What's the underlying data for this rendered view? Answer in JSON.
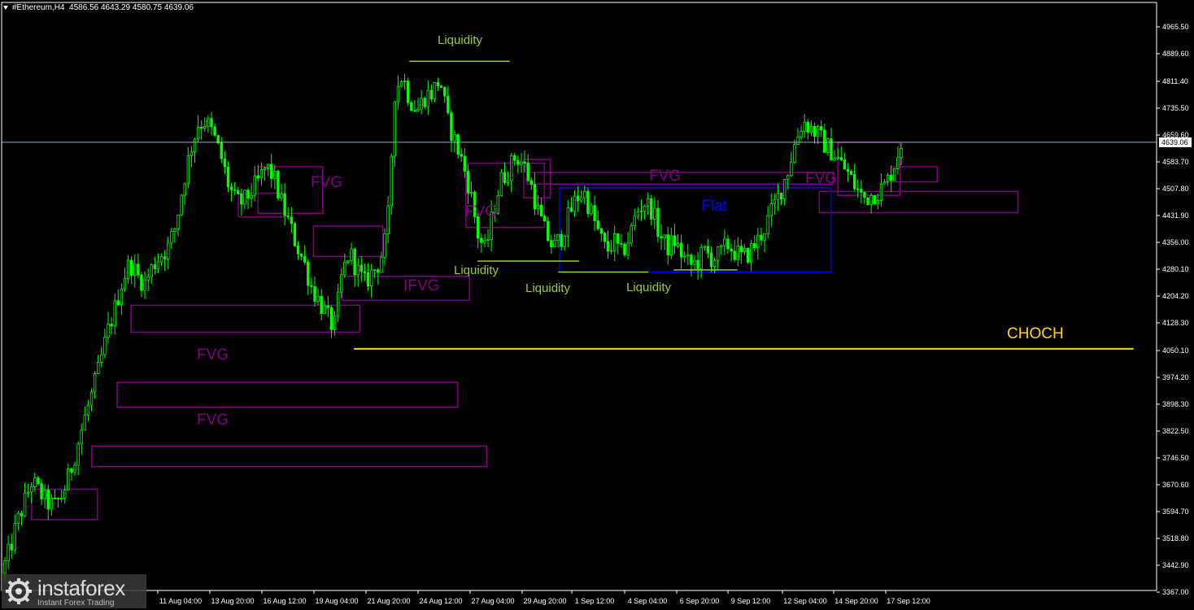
{
  "header": {
    "symbol": "#Ethereum,H4",
    "ohlc": "4586.56 4643.29 4580.75 4639.06"
  },
  "colors": {
    "background": "#000000",
    "candle": "#00ff00",
    "fvg": "#800080",
    "liquidity": "#9acd32",
    "flat": "#0000ff",
    "choch": "#ffd700",
    "axis": "#ffffff",
    "price_line": "#b0c4de"
  },
  "watermark": {
    "brand": "instaforex",
    "tagline": "Instant Forex Trading"
  },
  "chart_data": {
    "type": "candlestick",
    "symbol": "#Ethereum",
    "timeframe": "H4",
    "ylim": [
      3367,
      5000
    ],
    "y_ticks": [
      "4965.50",
      "4889.60",
      "4811.40",
      "4735.50",
      "4659.60",
      "4583.70",
      "4507.80",
      "4431.90",
      "4356.00",
      "4280.10",
      "4204.20",
      "4128.30",
      "4050.10",
      "3974.20",
      "3898.30",
      "3822.50",
      "3746.50",
      "3670.60",
      "3594.70",
      "3518.80",
      "3442.90",
      "3367.00"
    ],
    "x_ticks": [
      "11 Aug 04:00",
      "13 Aug 20:00",
      "16 Aug 12:00",
      "19 Aug 04:00",
      "21 Aug 20:00",
      "24 Aug 12:00",
      "27 Aug 04:00",
      "29 Aug 20:00",
      "1 Sep 12:00",
      "4 Sep 04:00",
      "6 Sep 20:00",
      "9 Sep 12:00",
      "12 Sep 04:00",
      "14 Sep 20:00",
      "17 Sep 12:00"
    ],
    "current_price": "4639.06",
    "price_path": [
      3420,
      3480,
      3560,
      3620,
      3680,
      3650,
      3620,
      3610,
      3640,
      3700,
      3780,
      3860,
      3930,
      4010,
      4100,
      4170,
      4250,
      4300,
      4260,
      4240,
      4290,
      4320,
      4340,
      4400,
      4520,
      4620,
      4690,
      4700,
      4660,
      4600,
      4520,
      4470,
      4470,
      4500,
      4530,
      4570,
      4540,
      4470,
      4410,
      4350,
      4300,
      4230,
      4190,
      4150,
      4110,
      4260,
      4330,
      4280,
      4240,
      4270,
      4300,
      4380,
      4780,
      4830,
      4760,
      4730,
      4770,
      4780,
      4820,
      4700,
      4640,
      4580,
      4500,
      4380,
      4330,
      4440,
      4530,
      4560,
      4600,
      4580,
      4520,
      4440,
      4380,
      4340,
      4370,
      4430,
      4480,
      4500,
      4440,
      4380,
      4330,
      4360,
      4320,
      4370,
      4440,
      4470,
      4450,
      4380,
      4340,
      4360,
      4320,
      4290,
      4300,
      4330,
      4310,
      4320,
      4350,
      4330,
      4310,
      4330,
      4360,
      4400,
      4450,
      4500,
      4560,
      4640,
      4700,
      4680,
      4660,
      4630,
      4610,
      4580,
      4550,
      4510,
      4480,
      4490,
      4500,
      4520,
      4570,
      4639
    ],
    "annotations": [
      {
        "type": "fvg",
        "label": "",
        "p_top": 4495,
        "p_bottom": 4428,
        "x_from": 0.205,
        "x_to": 0.245
      },
      {
        "type": "fvg",
        "label": "FVG",
        "p_top": 4570,
        "p_bottom": 4438,
        "x_from": 0.222,
        "x_to": 0.278
      },
      {
        "type": "fvg",
        "label": "",
        "p_top": 4402,
        "p_bottom": 4316,
        "x_from": 0.27,
        "x_to": 0.33
      },
      {
        "type": "fvg",
        "label": "IFVG",
        "p_top": 4260,
        "p_bottom": 4192,
        "x_from": 0.295,
        "x_to": 0.405
      },
      {
        "type": "fvg",
        "label": "FVG",
        "p_top": 4178,
        "p_bottom": 4102,
        "x_from": 0.112,
        "x_to": 0.31
      },
      {
        "type": "fvg",
        "label": "FVG",
        "p_top": 3960,
        "p_bottom": 3890,
        "x_from": 0.1,
        "x_to": 0.395
      },
      {
        "type": "fvg",
        "label": "",
        "p_top": 3780,
        "p_bottom": 3722,
        "x_from": 0.078,
        "x_to": 0.42
      },
      {
        "type": "fvg",
        "label": "",
        "p_top": 3658,
        "p_bottom": 3572,
        "x_from": 0.026,
        "x_to": 0.083
      },
      {
        "type": "fvg",
        "label": "FVG",
        "p_top": 4580,
        "p_bottom": 4398,
        "x_from": 0.402,
        "x_to": 0.47
      },
      {
        "type": "fvg",
        "label": "FVG",
        "p_top": 4554,
        "p_bottom": 4521,
        "x_from": 0.455,
        "x_to": 0.72
      },
      {
        "type": "fvg",
        "label": "",
        "p_top": 4591,
        "p_bottom": 4482,
        "x_from": 0.452,
        "x_to": 0.475
      },
      {
        "type": "fvg",
        "label": "FVG",
        "p_top": 4639,
        "p_bottom": 4489,
        "x_from": 0.724,
        "x_to": 0.778
      },
      {
        "type": "fvg",
        "label": "",
        "p_top": 4570,
        "p_bottom": 4527,
        "x_from": 0.77,
        "x_to": 0.81
      },
      {
        "type": "fvg",
        "label": "",
        "p_top": 4500,
        "p_bottom": 4440,
        "x_from": 0.708,
        "x_to": 0.88
      },
      {
        "type": "flat",
        "label": "Flat",
        "p_top": 4510,
        "p_bottom": 4272,
        "x_from": 0.483,
        "x_to": 0.718
      },
      {
        "type": "liquidity",
        "label": "Liquidity",
        "price": 4868,
        "x_from": 0.353,
        "x_to": 0.44
      },
      {
        "type": "liquidity",
        "label": "Liquidity",
        "price": 4303,
        "x_from": 0.412,
        "x_to": 0.5
      },
      {
        "type": "liquidity",
        "label": "Liquidity",
        "price": 4272,
        "x_from": 0.482,
        "x_to": 0.56
      },
      {
        "type": "liquidity",
        "label": "Liquidity",
        "price": 4278,
        "x_from": 0.582,
        "x_to": 0.637
      },
      {
        "type": "choch",
        "label": "CHOCH",
        "price": 4055,
        "x_from": 0.305,
        "x_to": 0.98
      }
    ]
  }
}
